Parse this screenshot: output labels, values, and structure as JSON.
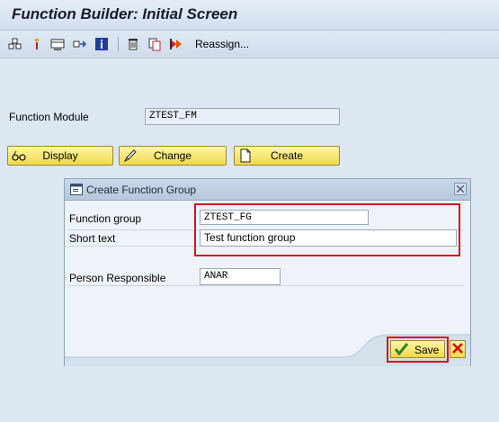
{
  "window": {
    "title": "Function Builder: Initial Screen"
  },
  "toolbar": {
    "icons": [
      "where-used-icon",
      "info-icon",
      "display-object-icon",
      "navigate-icon",
      "information-icon",
      "delete-icon",
      "copy-icon",
      "test-execute-icon"
    ],
    "reassign_label": "Reassign..."
  },
  "main": {
    "function_module_label": "Function Module",
    "function_module_value": "ZTEST_FM",
    "buttons": {
      "display": "Display",
      "change": "Change",
      "create": "Create"
    }
  },
  "dialog": {
    "title": "Create Function Group",
    "function_group_label": "Function group",
    "function_group_value": "ZTEST_FG",
    "short_text_label": "Short text",
    "short_text_value": "Test function group",
    "person_responsible_label": "Person Responsible",
    "person_responsible_value": "ANAR",
    "save_label": "Save"
  },
  "colors": {
    "highlight": "#d4141c",
    "button_yellow": "#f0d94a",
    "background": "#dde7f2"
  }
}
